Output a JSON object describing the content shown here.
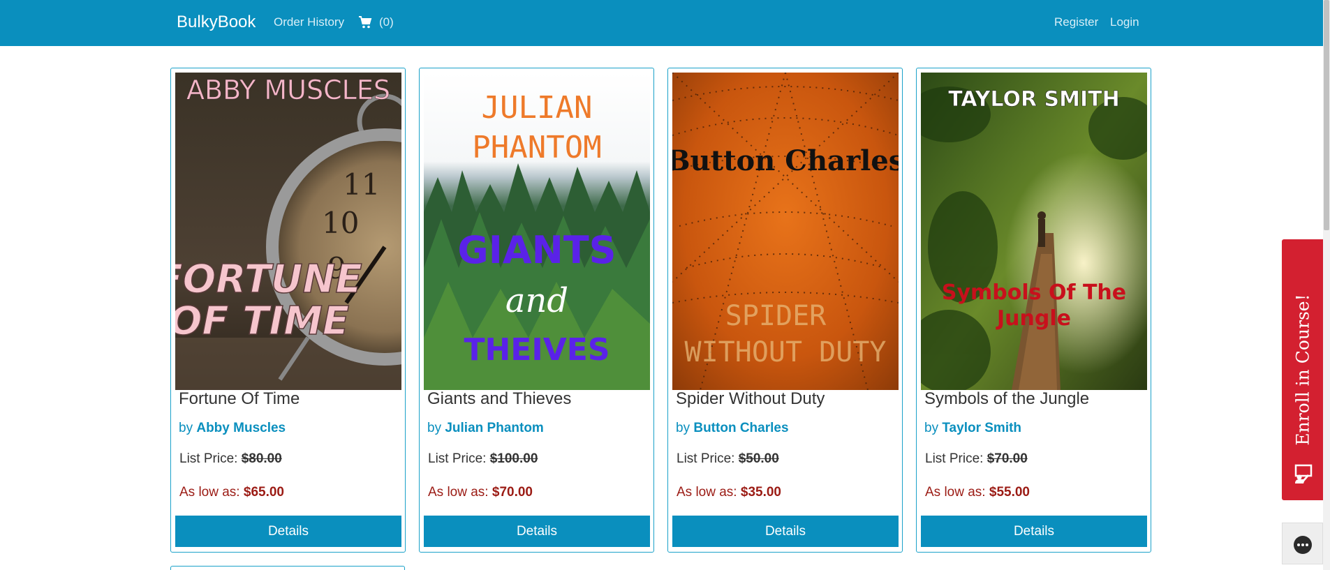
{
  "navbar": {
    "brand": "BulkyBook",
    "order_history": "Order History",
    "cart_icon": "shopping-cart-icon",
    "cart_count": "(0)",
    "register": "Register",
    "login": "Login",
    "background": "#0a8fbe"
  },
  "books": [
    {
      "title": "Fortune Of Time",
      "by": "by",
      "author": "Abby Muscles",
      "list_label": "List Price:",
      "list_price": "$80.00",
      "low_label": "As low as:",
      "low_price": "$65.00",
      "button": "Details",
      "cover": {
        "top_text": "ABBY MUSCLES",
        "line1": "FORTUNE",
        "line2": "OF TIME"
      }
    },
    {
      "title": "Giants and Thieves",
      "by": "by",
      "author": "Julian Phantom",
      "list_label": "List Price:",
      "list_price": "$100.00",
      "low_label": "As low as:",
      "low_price": "$70.00",
      "button": "Details",
      "cover": {
        "top1": "JULIAN",
        "top2": "PHANTOM",
        "line1": "GIANTS",
        "line2": "and",
        "line3": "THEIVES"
      }
    },
    {
      "title": "Spider Without Duty",
      "by": "by",
      "author": "Button Charles",
      "list_label": "List Price:",
      "list_price": "$50.00",
      "low_label": "As low as:",
      "low_price": "$35.00",
      "button": "Details",
      "cover": {
        "top_text": "Button Charles",
        "line1": "SPIDER",
        "line2": "WITHOUT DUTY"
      }
    },
    {
      "title": "Symbols of the Jungle",
      "by": "by",
      "author": "Taylor Smith",
      "list_label": "List Price:",
      "list_price": "$70.00",
      "low_label": "As low as:",
      "low_price": "$55.00",
      "button": "Details",
      "cover": {
        "top_text": "TAYLOR SMITH",
        "line1": "Symbols Of The",
        "line2": "Jungle"
      }
    }
  ],
  "enroll": {
    "label": "Enroll in Course!",
    "icon": "chalkboard-teacher-icon",
    "color": "#d32030"
  },
  "chat": {
    "icon": "chat-bubble-icon"
  }
}
